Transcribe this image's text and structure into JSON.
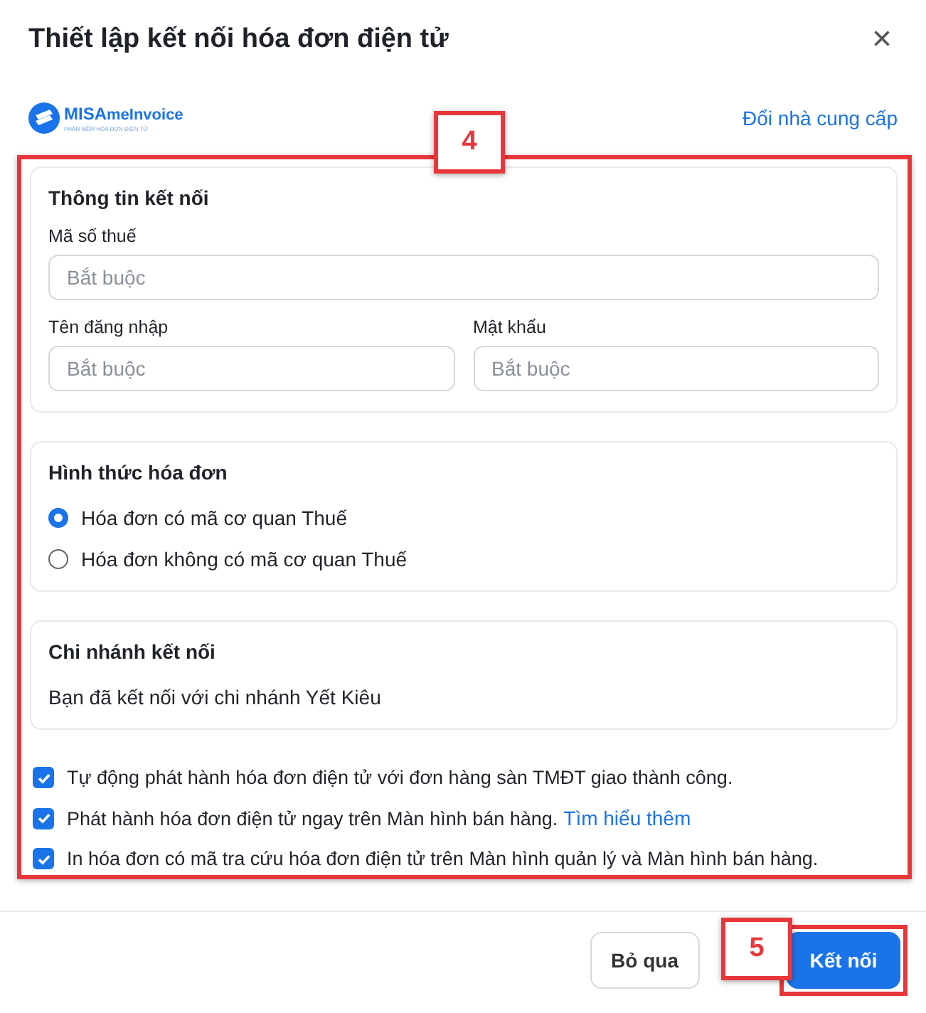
{
  "dialog": {
    "title": "Thiết lập kết nối hóa đơn điện tử",
    "close": "×"
  },
  "provider": {
    "logo": {
      "brand": "MISA",
      "product": "meInvoice",
      "tagline": "PHẦN MỀM HÓA ĐƠN ĐIỆN TỬ"
    },
    "change_link": "Đổi nhà cung cấp"
  },
  "connection_info": {
    "title": "Thông tin kết nối",
    "fields": [
      {
        "label": "Mã số thuế",
        "placeholder": "Bắt buộc"
      },
      {
        "label": "Tên đăng nhập",
        "placeholder": "Bắt buộc"
      },
      {
        "label": "Mật khẩu",
        "placeholder": "Bắt buộc"
      }
    ]
  },
  "invoice_type": {
    "title": "Hình thức hóa đơn",
    "options": [
      {
        "label": "Hóa đơn có mã cơ quan Thuế",
        "selected": true
      },
      {
        "label": "Hóa đơn không có mã cơ quan Thuế",
        "selected": false
      }
    ]
  },
  "branch": {
    "title": "Chi nhánh kết nối",
    "text": "Bạn đã kết nối với chi nhánh Yết Kiêu"
  },
  "options": [
    {
      "label": "Tự động phát hành hóa đơn điện tử với đơn hàng sàn TMĐT giao thành công.",
      "checked": true
    },
    {
      "label": "Phát hành hóa đơn điện tử ngay trên Màn hình bán hàng.",
      "link": "Tìm hiểu thêm",
      "checked": true
    },
    {
      "label": "In hóa đơn có mã tra cứu hóa đơn điện tử trên Màn hình quản lý và Màn hình bán hàng.",
      "checked": true
    }
  ],
  "buttons": [
    {
      "label": "Bỏ qua",
      "kind": "secondary"
    },
    {
      "label": "Kết nối",
      "kind": "primary"
    }
  ],
  "callouts": [
    {
      "number": "4"
    },
    {
      "number": "5"
    }
  ]
}
